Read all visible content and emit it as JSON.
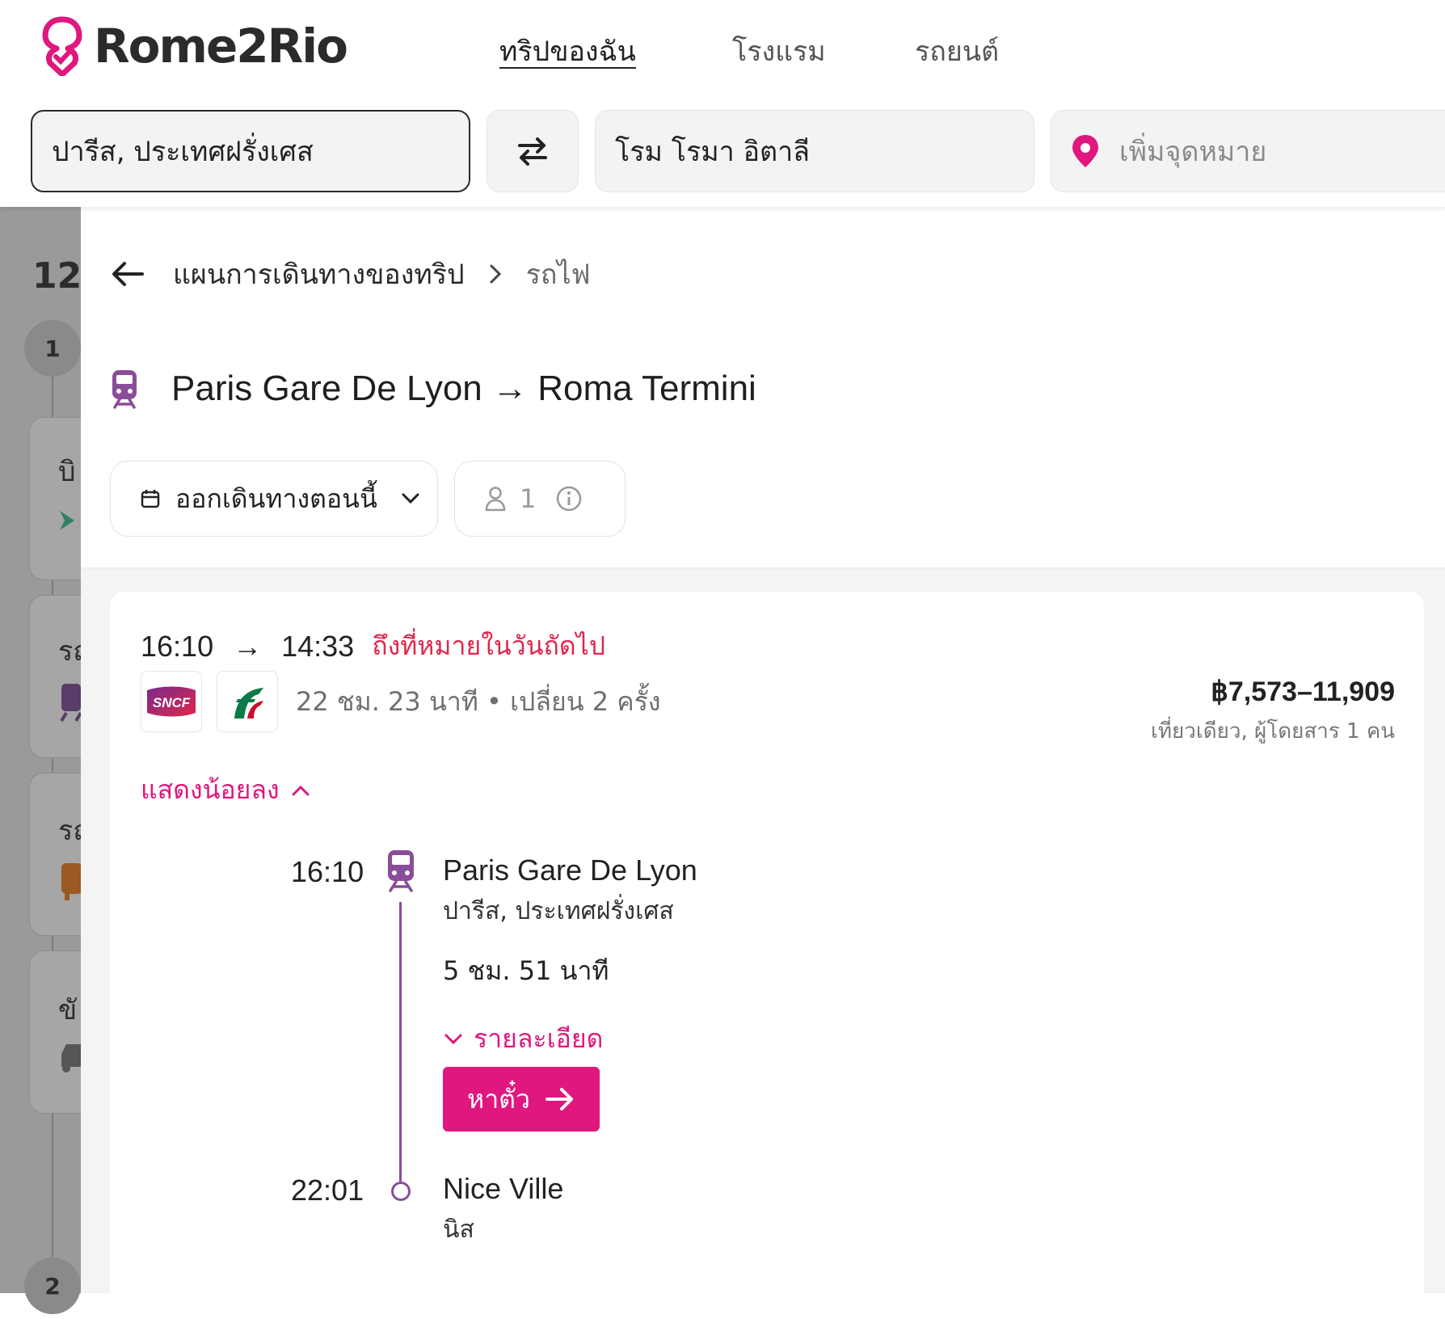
{
  "brand": {
    "name": "Rome2Rio",
    "accent": "#e0177f",
    "text_color": "#2b2b2b"
  },
  "nav": {
    "my_trip": "ทริปของฉัน",
    "hotels": "โรงแรม",
    "cars": "รถยนต์"
  },
  "search": {
    "origin": "ปารีส, ประเทศฝรั่งเศส",
    "destination": "โรม โรมา อิตาลี",
    "add_destination_placeholder": "เพิ่มจุดหมาย"
  },
  "sidebar": {
    "count": "12",
    "steps": [
      "1",
      "2"
    ],
    "cards": [
      {
        "label": "บิ",
        "icon": "plane-icon"
      },
      {
        "label": "รถ",
        "icon": "train-icon"
      },
      {
        "label": "รถ",
        "icon": "bus-icon"
      },
      {
        "label": "ขั",
        "icon": "car-icon"
      }
    ]
  },
  "breadcrumb": {
    "parent": "แผนการเดินทางของทริป",
    "current": "รถไฟ"
  },
  "route": {
    "title": "Paris Gare De Lyon → Roma Termini"
  },
  "filters": {
    "depart_label": "ออกเดินทางตอนนี้",
    "passengers": "1"
  },
  "result": {
    "depart_time": "16:10",
    "arrive_time": "14:33",
    "arrow": "→",
    "next_day_note": "ถึงที่หมายในวันถัดไป",
    "operators": [
      "SNCF",
      "Trenitalia"
    ],
    "duration_summary": "22 ชม. 23 นาที • เปลี่ยน 2 ครั้ง",
    "price": "฿7,573–11,909",
    "price_note": "เที่ยวเดียว, ผู้โดยสาร 1 คน",
    "show_less": "แสดงน้อยลง"
  },
  "timeline": {
    "stop1": {
      "time": "16:10",
      "name": "Paris Gare De Lyon",
      "city": "ปารีส, ประเทศฝรั่งเศส"
    },
    "segment": {
      "duration": "5 ชม. 51 นาที",
      "details": "รายละเอียด",
      "ticket_button": "หาตั๋ว"
    },
    "stop2": {
      "time": "22:01",
      "name": "Nice Ville",
      "city": "นิส"
    }
  }
}
